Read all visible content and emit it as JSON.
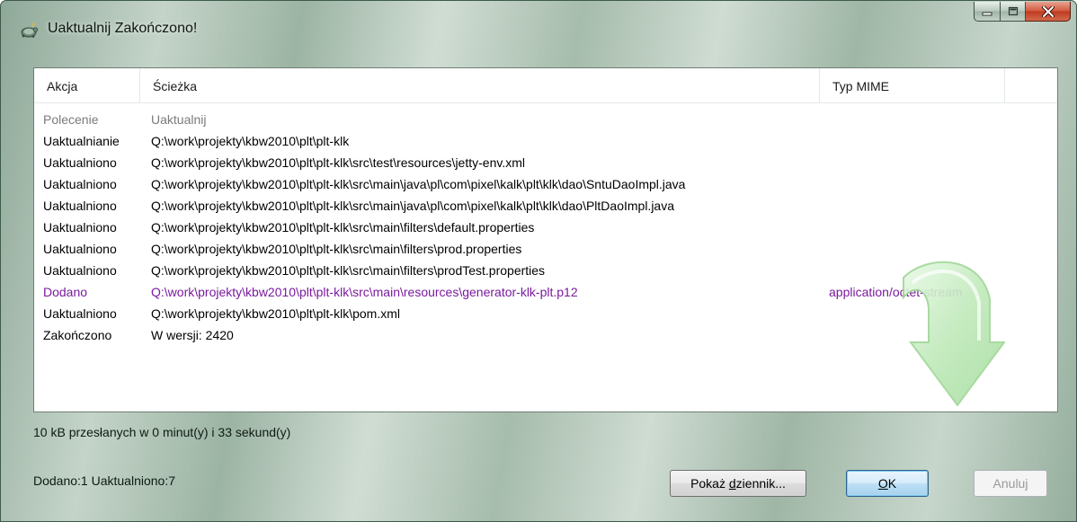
{
  "window": {
    "title": "Uaktualnij Zakończono!",
    "caption_icons": [
      "minimize-icon",
      "maximize-icon",
      "close-icon"
    ]
  },
  "list": {
    "columns": [
      "Akcja",
      "Ścieżka",
      "Typ MIME"
    ],
    "rows": [
      {
        "action": "Polecenie",
        "path": "Uaktualnij",
        "mime": "",
        "style": "gray"
      },
      {
        "action": "Uaktualnianie",
        "path": "Q:\\work\\projekty\\kbw2010\\plt\\plt-klk",
        "mime": "",
        "style": "normal"
      },
      {
        "action": "Uaktualniono",
        "path": "Q:\\work\\projekty\\kbw2010\\plt\\plt-klk\\src\\test\\resources\\jetty-env.xml",
        "mime": "",
        "style": "normal"
      },
      {
        "action": "Uaktualniono",
        "path": "Q:\\work\\projekty\\kbw2010\\plt\\plt-klk\\src\\main\\java\\pl\\com\\pixel\\kalk\\plt\\klk\\dao\\SntuDaoImpl.java",
        "mime": "",
        "style": "normal"
      },
      {
        "action": "Uaktualniono",
        "path": "Q:\\work\\projekty\\kbw2010\\plt\\plt-klk\\src\\main\\java\\pl\\com\\pixel\\kalk\\plt\\klk\\dao\\PltDaoImpl.java",
        "mime": "",
        "style": "normal"
      },
      {
        "action": "Uaktualniono",
        "path": "Q:\\work\\projekty\\kbw2010\\plt\\plt-klk\\src\\main\\filters\\default.properties",
        "mime": "",
        "style": "normal"
      },
      {
        "action": "Uaktualniono",
        "path": "Q:\\work\\projekty\\kbw2010\\plt\\plt-klk\\src\\main\\filters\\prod.properties",
        "mime": "",
        "style": "normal"
      },
      {
        "action": "Uaktualniono",
        "path": "Q:\\work\\projekty\\kbw2010\\plt\\plt-klk\\src\\main\\filters\\prodTest.properties",
        "mime": "",
        "style": "normal"
      },
      {
        "action": "Dodano",
        "path": "Q:\\work\\projekty\\kbw2010\\plt\\plt-klk\\src\\main\\resources\\generator-klk-plt.p12",
        "mime": "application/octet-stream",
        "style": "purple"
      },
      {
        "action": "Uaktualniono",
        "path": "Q:\\work\\projekty\\kbw2010\\plt\\plt-klk\\pom.xml",
        "mime": "",
        "style": "normal"
      },
      {
        "action": "Zakończono",
        "path": "W wersji: 2420",
        "mime": "",
        "style": "normal"
      }
    ],
    "decoration_icon": "green-curved-arrow-icon"
  },
  "status_text": "10 kB przesłanych w 0 minut(y) i 33 sekund(y)",
  "summary_text": "Dodano:1 Uaktualniono:7",
  "buttons": {
    "show_log": {
      "before": "Pokaż ",
      "mnemonic": "d",
      "after": "ziennik..."
    },
    "ok": {
      "before": "",
      "mnemonic": "O",
      "after": "K"
    },
    "cancel": "Anuluj"
  },
  "colors": {
    "added_row": "#7a1a9e",
    "command_row": "#7a7a7a"
  }
}
